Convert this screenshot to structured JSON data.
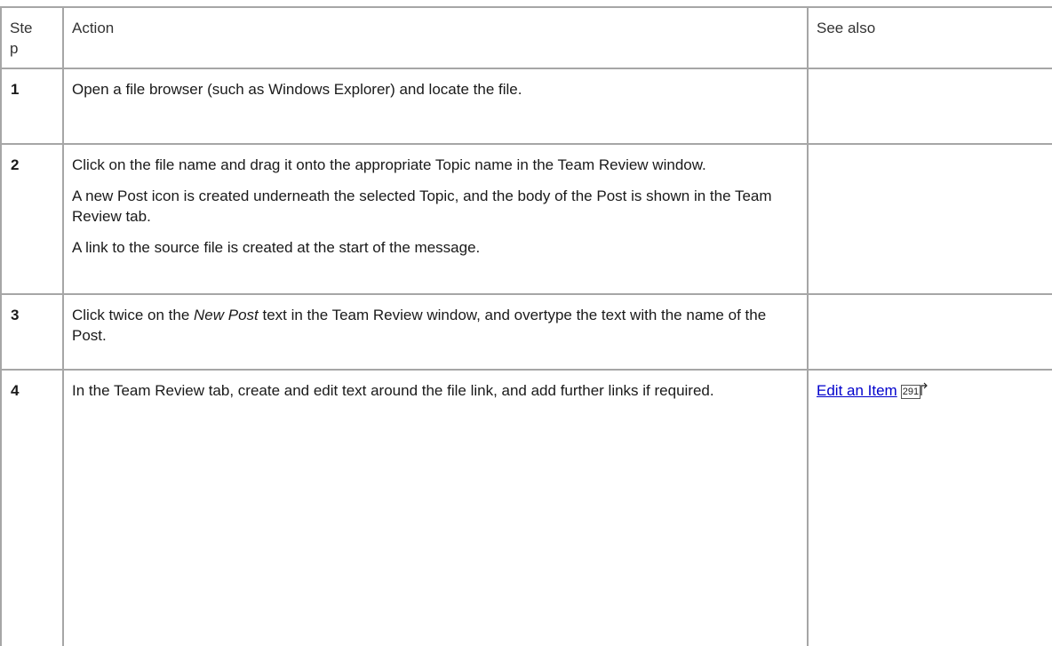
{
  "header": {
    "step": "Step",
    "action": "Action",
    "see_also": "See also"
  },
  "rows": [
    {
      "step": "1",
      "paragraphs": [
        {
          "parts": [
            {
              "text": "Open a file browser (such as Windows Explorer) and locate the file."
            }
          ]
        }
      ],
      "see_also": null
    },
    {
      "step": "2",
      "paragraphs": [
        {
          "parts": [
            {
              "text": "Click on the file name and drag it onto the appropriate Topic name in the Team Review window."
            }
          ]
        },
        {
          "parts": [
            {
              "text": "A new Post icon is created underneath the selected Topic, and the body of the Post is shown in the Team Review tab."
            }
          ]
        },
        {
          "parts": [
            {
              "text": "A link to the source file is created at the start of the message."
            }
          ]
        }
      ],
      "see_also": null
    },
    {
      "step": "3",
      "paragraphs": [
        {
          "parts": [
            {
              "text": "Click twice on the "
            },
            {
              "text": "New Post",
              "italic": true
            },
            {
              "text": " text in the Team Review window, and overtype the text with the name of the Post."
            }
          ]
        }
      ],
      "see_also": null
    },
    {
      "step": "4",
      "paragraphs": [
        {
          "parts": [
            {
              "text": "In the Team Review tab, create and edit text around the file link, and add further links if required."
            }
          ]
        }
      ],
      "see_also": {
        "link_text": "Edit an Item",
        "page": "291",
        "icon": "page-reference-arrow-icon"
      }
    }
  ]
}
